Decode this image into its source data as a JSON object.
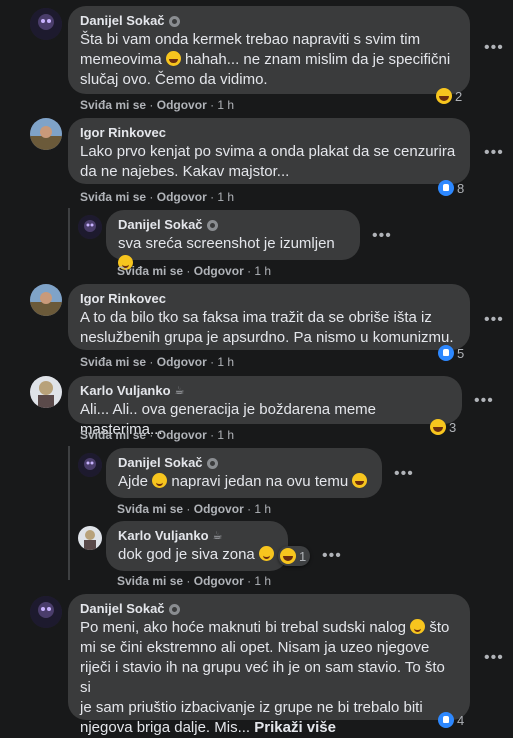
{
  "actions": {
    "like": "Sviđa mi se",
    "reply": "Odgovor",
    "sep": "·"
  },
  "comments": [
    {
      "name": "Danijel Sokač",
      "lines": [
        "Šta bi vam onda kermek trebao napraviti s svim tim",
        "memeovima",
        "hahah... ne znam mislim da je specifični",
        "slučaj ovo. Čemo da vidimo."
      ],
      "time": "1 h",
      "reaction_count": "2"
    },
    {
      "name": "Igor Rinkovec",
      "lines": [
        "Lako prvo kenjat po svima a onda plakat da se cenzurira",
        "da ne najebes. Kakav majstor..."
      ],
      "time": "1 h",
      "reaction_count": "8"
    },
    {
      "name": "Danijel Sokač",
      "lines": [
        "sva sreća screenshot je izumljen"
      ],
      "time": "1 h"
    },
    {
      "name": "Igor Rinkovec",
      "lines": [
        "A to da bilo tko sa faksa ima tražit da se obriše išta iz",
        "neslužbenih grupa je apsurdno. Pa nismo u komunizmu."
      ],
      "time": "1 h",
      "reaction_count": "5"
    },
    {
      "name": "Karlo Vuljanko",
      "lines": [
        "Ali... Ali.. ova generacija je boždarena meme masterima..."
      ],
      "time": "1 h",
      "reaction_count": "3"
    },
    {
      "name": "Danijel Sokač",
      "lines": [
        "Ajde",
        "napravi jedan na ovu temu"
      ],
      "time": "1 h"
    },
    {
      "name": "Karlo Vuljanko",
      "lines": [
        "dok god je siva zona"
      ],
      "time": "1 h",
      "reaction_count": "1"
    },
    {
      "name": "Danijel Sokač",
      "lines": [
        "Po meni, ako hoće maknuti bi trebal sudski nalog",
        "što",
        "mi se čini ekstremno ali opet. Nisam ja uzeo njegove",
        "riječi i stavio ih na grupu već ih je on sam stavio. To što si",
        "je sam priuštio izbacivanje iz grupe ne bi trebalo biti",
        "njegova briga dalje. Mis...",
        "Prikaži više"
      ],
      "time": "",
      "reaction_count": "4"
    }
  ],
  "icons": {
    "more": "more-options-icon",
    "badge": "top-fan-badge-icon",
    "cup": "coffee-cup-icon"
  },
  "colors": {
    "bg": "#18191a",
    "bubble": "#3a3b3c",
    "text": "#e4e6eb",
    "muted": "#b0b3b8",
    "like": "#2d88ff",
    "haha": "#f7c51e"
  }
}
